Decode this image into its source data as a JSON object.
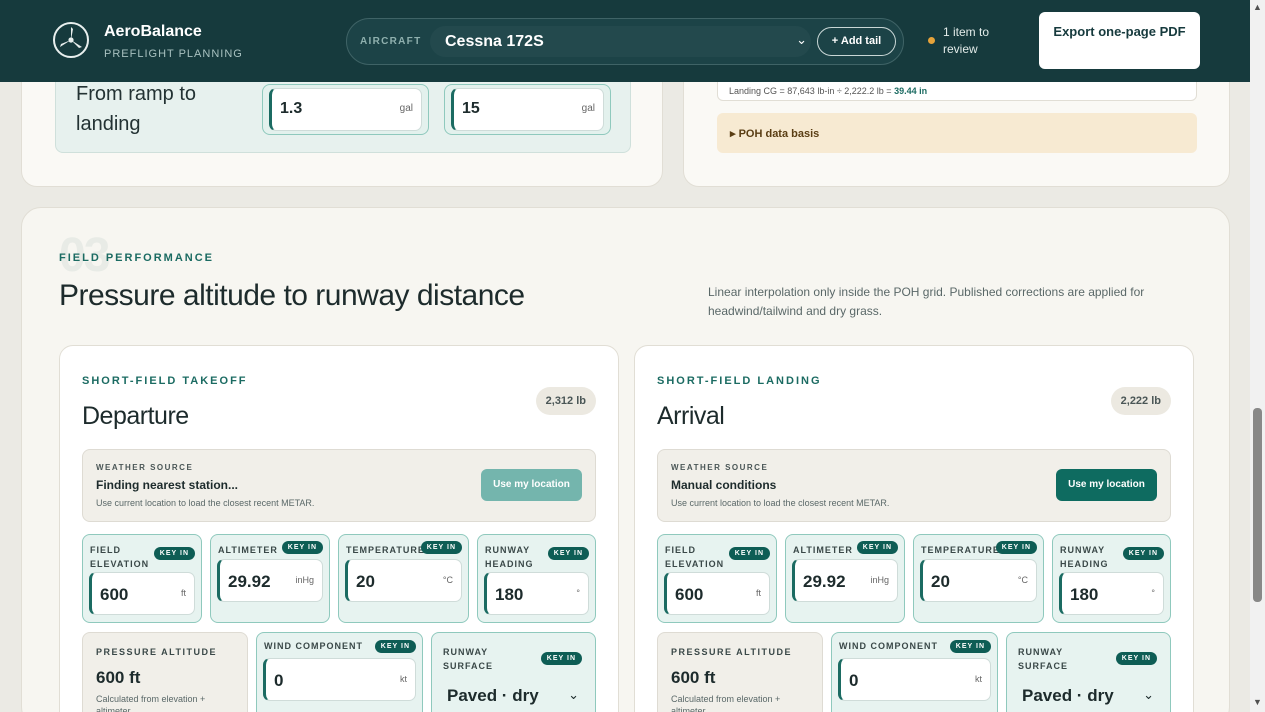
{
  "header": {
    "brand_name": "AeroBalance",
    "brand_sub": "PREFLIGHT PLANNING",
    "aircraft_label": "AIRCRAFT",
    "aircraft_value": "Cessna 172S",
    "add_tail_label": "+ Add tail",
    "review_text": "1 item to review",
    "export_label": "Export one-page PDF"
  },
  "fuel": {
    "label": "From ramp to landing",
    "box1_value": "1.3",
    "box1_unit": "gal",
    "box2_value": "15",
    "box2_unit": "gal"
  },
  "cg": {
    "calc_prefix": "Landing CG = 87,643 lb-in ÷ 2,222.2 lb = ",
    "calc_result": "39.44 in",
    "poh_label": "▸ POH data basis"
  },
  "section": {
    "number": "03",
    "eyebrow": "FIELD PERFORMANCE",
    "title": "Pressure altitude to runway distance",
    "note": "Linear interpolation only inside the POH grid. Published corrections are applied for headwind/tailwind and dry grass."
  },
  "common": {
    "key_in": "KEY IN",
    "weather_label": "WEATHER SOURCE",
    "weather_help": "Use current location to load the closest recent METAR.",
    "location_btn": "Use my location",
    "field_elevation_label": "FIELD ELEVATION",
    "altimeter_label": "ALTIMETER",
    "temperature_label": "TEMPERATURE",
    "runway_heading_label": "RUNWAY HEADING",
    "pressure_alt_label": "PRESSURE ALTITUDE",
    "pressure_alt_help": "Calculated from elevation + altimeter",
    "wind_label": "WIND COMPONENT",
    "surface_label": "RUNWAY SURFACE"
  },
  "takeoff": {
    "eyebrow": "SHORT-FIELD TAKEOFF",
    "title": "Departure",
    "weight": "2,312 lb",
    "weather_status": "Finding nearest station...",
    "elevation": "600",
    "elevation_unit": "ft",
    "altimeter": "29.92",
    "altimeter_unit": "inHg",
    "temperature": "20",
    "temperature_unit": "°C",
    "heading": "180",
    "heading_unit": "°",
    "pressure_alt": "600 ft",
    "wind": "0",
    "wind_unit": "kt",
    "surface": "Paved · dry"
  },
  "landing": {
    "eyebrow": "SHORT-FIELD LANDING",
    "title": "Arrival",
    "weight": "2,222 lb",
    "weather_status": "Manual conditions",
    "elevation": "600",
    "elevation_unit": "ft",
    "altimeter": "29.92",
    "altimeter_unit": "inHg",
    "temperature": "20",
    "temperature_unit": "°C",
    "heading": "180",
    "heading_unit": "°",
    "pressure_alt": "600 ft",
    "wind": "0",
    "wind_unit": "kt",
    "surface": "Paved · dry"
  },
  "colors": {
    "header_bg": "#163a3d",
    "accent": "#1b6b62",
    "review_dot": "#e6a33a"
  },
  "icons": [
    "propeller-logo-icon",
    "chevron-down-icon",
    "scroll-up-arrow-icon",
    "scroll-down-arrow-icon"
  ]
}
